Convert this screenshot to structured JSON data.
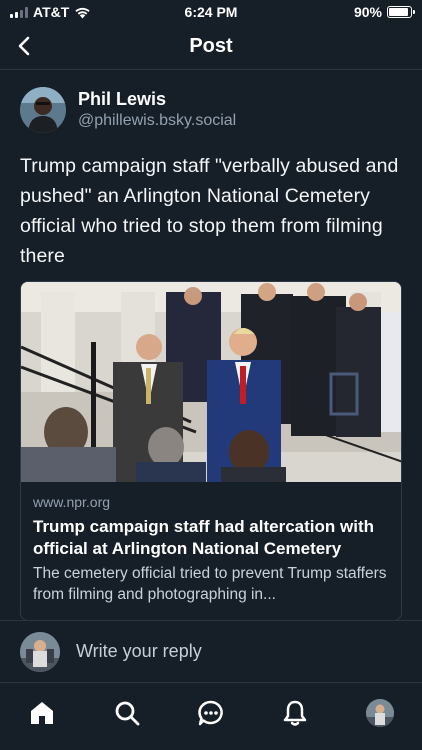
{
  "status_bar": {
    "carrier": "AT&T",
    "time": "6:24 PM",
    "battery_percent": "90%",
    "battery_level": 0.9
  },
  "header": {
    "title": "Post",
    "back_icon": "chevron-left-icon"
  },
  "post": {
    "author_name": "Phil Lewis",
    "author_handle": "@phillewis.bsky.social",
    "text": "Trump campaign staff \"verbally abused and pushed\" an Arlington National Cemetery official who tried to stop them from filming there"
  },
  "link_card": {
    "domain": "www.npr.org",
    "title": "Trump campaign staff had altercation with official at Arlington National Cemetery",
    "description": "The cemetery official tried to prevent Trump staffers from filming and photographing in..."
  },
  "reply": {
    "placeholder": "Write your reply"
  },
  "nav": {
    "items": [
      "home-icon",
      "search-icon",
      "chat-icon",
      "bell-icon",
      "profile-avatar"
    ]
  },
  "colors": {
    "background": "#161e27",
    "border": "#2a3441",
    "muted_text": "#93a1b0"
  }
}
